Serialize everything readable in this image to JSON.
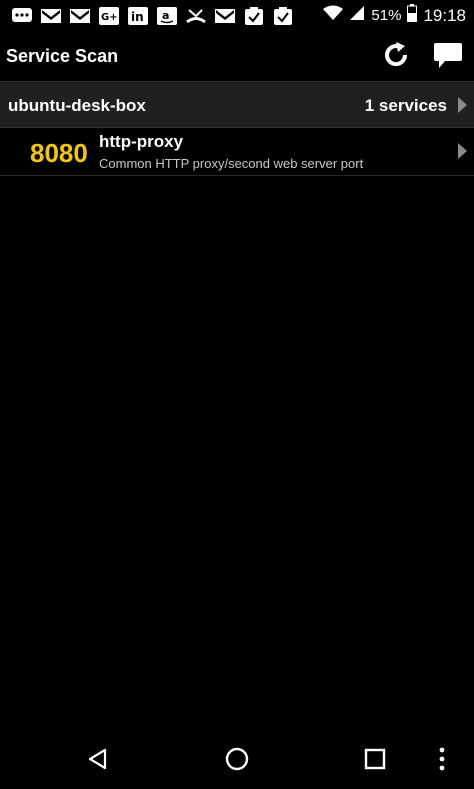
{
  "status_bar": {
    "notification_icons": [
      "chat-bubble-icon",
      "gmail-icon",
      "gmail-icon",
      "google-plus-icon",
      "linkedin-icon",
      "amazon-icon",
      "missed-call-icon",
      "gmail-icon",
      "task-check-icon",
      "task-check-icon"
    ],
    "battery": "51%",
    "time": "19:18"
  },
  "action_bar": {
    "title": "Service Scan",
    "refresh_icon": "refresh-icon",
    "chat_icon": "chat-bubble-icon"
  },
  "host": {
    "name": "ubuntu-desk-box",
    "count": "1 services"
  },
  "services": [
    {
      "port": "8080",
      "name": "http-proxy",
      "description": "Common HTTP proxy/second web server port"
    }
  ],
  "nav_bar": {
    "back": "back-icon",
    "home": "home-icon",
    "recents": "recents-icon",
    "menu": "overflow-menu-icon"
  },
  "colors": {
    "port_color": "#f5c800",
    "header_bg": "#202020"
  }
}
